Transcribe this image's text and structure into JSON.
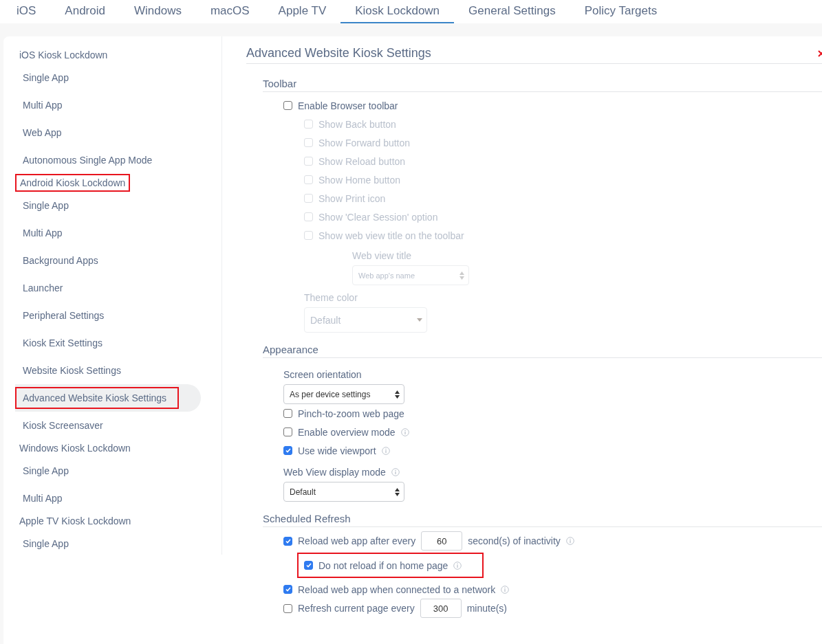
{
  "tabs": [
    {
      "label": "iOS",
      "selected": false
    },
    {
      "label": "Android",
      "selected": false
    },
    {
      "label": "Windows",
      "selected": false
    },
    {
      "label": "macOS",
      "selected": false
    },
    {
      "label": "Apple TV",
      "selected": false
    },
    {
      "label": "Kiosk Lockdown",
      "selected": true
    },
    {
      "label": "General Settings",
      "selected": false
    },
    {
      "label": "Policy Targets",
      "selected": false
    }
  ],
  "sidebar": {
    "groups": [
      {
        "label": "iOS Kiosk Lockdown",
        "highlighted": false,
        "children": [
          {
            "label": "Single App",
            "selected": false,
            "highlighted": false
          },
          {
            "label": "Multi App",
            "selected": false,
            "highlighted": false
          },
          {
            "label": "Web App",
            "selected": false,
            "highlighted": false
          },
          {
            "label": "Autonomous Single App Mode",
            "selected": false,
            "highlighted": false
          }
        ]
      },
      {
        "label": "Android Kiosk Lockdown",
        "highlighted": true,
        "children": [
          {
            "label": "Single App",
            "selected": false,
            "highlighted": false
          },
          {
            "label": "Multi App",
            "selected": false,
            "highlighted": false
          },
          {
            "label": "Background Apps",
            "selected": false,
            "highlighted": false
          },
          {
            "label": "Launcher",
            "selected": false,
            "highlighted": false
          },
          {
            "label": "Peripheral Settings",
            "selected": false,
            "highlighted": false
          },
          {
            "label": "Kiosk Exit Settings",
            "selected": false,
            "highlighted": false
          },
          {
            "label": "Website Kiosk Settings",
            "selected": false,
            "highlighted": false
          },
          {
            "label": "Advanced Website Kiosk Settings",
            "selected": true,
            "highlighted": true
          },
          {
            "label": "Kiosk Screensaver",
            "selected": false,
            "highlighted": false
          }
        ]
      },
      {
        "label": "Windows Kiosk Lockdown",
        "highlighted": false,
        "children": [
          {
            "label": "Single App",
            "selected": false,
            "highlighted": false
          },
          {
            "label": "Multi App",
            "selected": false,
            "highlighted": false
          }
        ]
      },
      {
        "label": "Apple TV Kiosk Lockdown",
        "highlighted": false,
        "children": [
          {
            "label": "Single App",
            "selected": false,
            "highlighted": false
          }
        ]
      }
    ]
  },
  "content": {
    "title": "Advanced Website Kiosk Settings",
    "sections": [
      {
        "heading": "Toolbar",
        "items": [
          {
            "kind": "checkbox",
            "label": "Enable Browser toolbar",
            "checked": false,
            "disabled": false,
            "children": [
              {
                "kind": "checkbox",
                "label": "Show Back button",
                "checked": false,
                "disabled": true
              },
              {
                "kind": "checkbox",
                "label": "Show Forward button",
                "checked": false,
                "disabled": true
              },
              {
                "kind": "checkbox",
                "label": "Show Reload button",
                "checked": false,
                "disabled": true
              },
              {
                "kind": "checkbox",
                "label": "Show Home button",
                "checked": false,
                "disabled": true
              },
              {
                "kind": "checkbox",
                "label": "Show Print icon",
                "checked": false,
                "disabled": true
              },
              {
                "kind": "checkbox",
                "label": "Show 'Clear Session' option",
                "checked": false,
                "disabled": true
              },
              {
                "kind": "checkbox",
                "label": "Show web view title on the toolbar",
                "checked": false,
                "disabled": true,
                "children": [
                  {
                    "kind": "select",
                    "label": "Web view title",
                    "value": "Web app's name",
                    "disabled": true
                  }
                ]
              },
              {
                "kind": "dropdown",
                "label": "Theme color",
                "value": "Default",
                "disabled": true
              }
            ]
          }
        ]
      },
      {
        "heading": "Appearance",
        "items": [
          {
            "kind": "select",
            "label": "Screen orientation",
            "value": "As per device settings",
            "disabled": false
          },
          {
            "kind": "checkbox",
            "label": "Pinch-to-zoom web page",
            "checked": false,
            "disabled": false
          },
          {
            "kind": "checkbox",
            "label": "Enable overview mode",
            "checked": false,
            "disabled": false,
            "info": true
          },
          {
            "kind": "checkbox",
            "label": "Use wide viewport",
            "checked": true,
            "disabled": false,
            "info": true
          },
          {
            "kind": "select",
            "label": "Web View display mode",
            "value": "Default",
            "disabled": false,
            "info": true
          }
        ]
      },
      {
        "heading": "Scheduled Refresh",
        "items": [
          {
            "kind": "checkbox",
            "label": "Reload web app after every",
            "checked": true,
            "disabled": false,
            "input": "60",
            "suffix": "second(s) of inactivity",
            "info": true,
            "children": [
              {
                "kind": "checkbox",
                "label": "Do not reload if on home page",
                "checked": true,
                "disabled": false,
                "info": true,
                "highlighted": true
              }
            ]
          },
          {
            "kind": "checkbox",
            "label": "Reload web app when connected to a network",
            "checked": true,
            "disabled": false,
            "info": true
          },
          {
            "kind": "checkbox",
            "label": "Refresh current page every",
            "checked": false,
            "disabled": false,
            "input": "300",
            "suffix": "minute(s)"
          }
        ]
      }
    ]
  }
}
